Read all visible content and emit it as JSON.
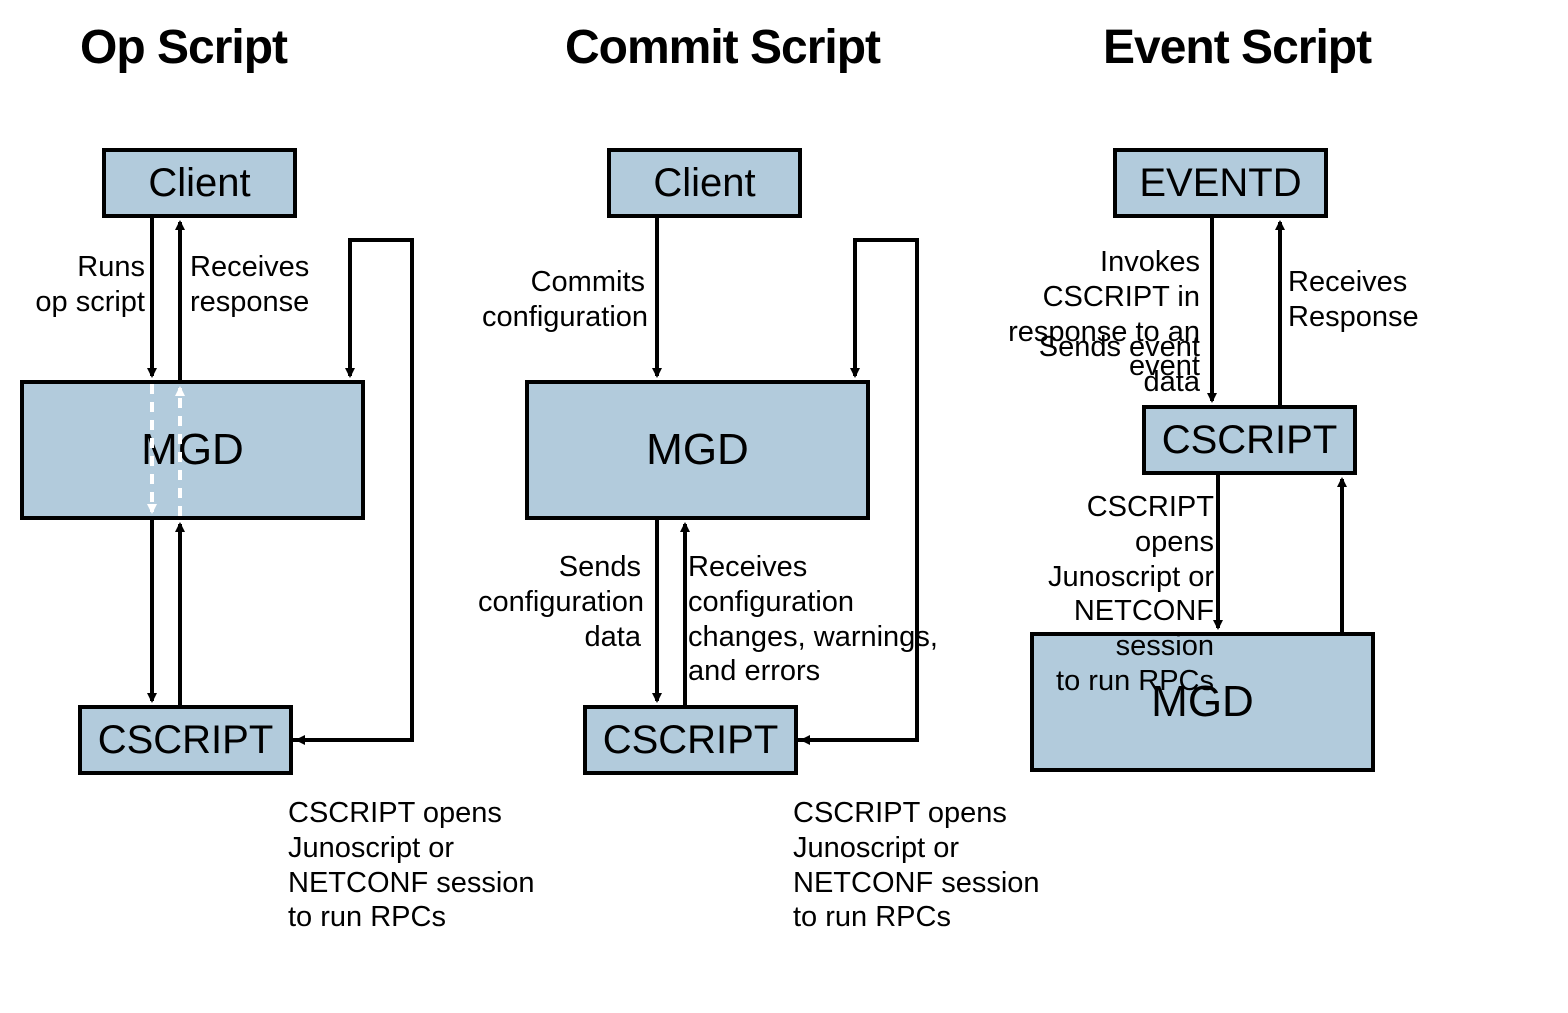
{
  "sections": {
    "op": "Op Script",
    "commit": "Commit Script",
    "event": "Event Script"
  },
  "boxes": {
    "client": "Client",
    "mgd": "MGD",
    "cscript": "CSCRIPT",
    "eventd": "EVENTD"
  },
  "labels": {
    "opRuns": "Runs\nop script",
    "opReceives": "Receives\nresponse",
    "commitCommits": "Commits\nconfiguration",
    "commitSends": "Sends\nconfiguration\ndata",
    "commitReceives": "Receives\nconfiguration\nchanges, warnings,\nand errors",
    "eventInvokes": "Invokes CSCRIPT in\nresponse to an event",
    "eventSendsData": "Sends event data",
    "eventReceivesResp": "Receives\nResponse",
    "eventOpens": "CSCRIPT opens\nJunoscript or\nNETCONF session\nto run RPCs",
    "cscriptOpens": "CSCRIPT opens\nJunoscript or\nNETCONF session\nto run RPCs"
  },
  "colors": {
    "box": "#b2cbdc",
    "stroke": "#000000"
  }
}
